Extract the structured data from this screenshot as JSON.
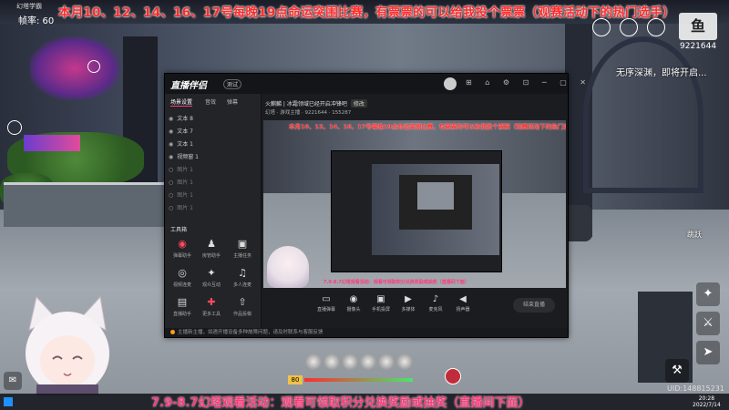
{
  "top_banner": "本月10、12、14、16、17号每晚19点命运突围比赛，有票票的可以给我投个票票（观赛活动下的热门选手）",
  "bottom_banner": "7.9-8.7幻塔观看活动：观看可领取积分兑换奖励或抽奖（直播间下面）",
  "game": {
    "fps_label": "帧率: 60",
    "tl_tab": "幻塔学霸",
    "right_logo": "鱼",
    "right_id": "9221644",
    "right_notice": "无序深渊，即将开启...",
    "hp_value": "80",
    "hp_fill_fraction": 0.85,
    "uid": "UID:148815231",
    "clock_time": "20:28",
    "clock_date": "2022/7/14",
    "right_label": "跳跃"
  },
  "app": {
    "logo": "直播伴侣",
    "logo_badge": "测试",
    "win_controls": "⊞ ⌂ ⚙ ⊡ ─ ▢ ✕",
    "left_tabs": [
      "场景设置",
      "音效",
      "弹幕"
    ],
    "layers": [
      {
        "label": "文本 8"
      },
      {
        "label": "文本 7"
      },
      {
        "label": "文本 1"
      },
      {
        "label": "视频窗 1"
      },
      {
        "label": "图片 1"
      },
      {
        "label": "图片 1"
      },
      {
        "label": "图片 1"
      },
      {
        "label": "图片 1"
      }
    ],
    "tools_title": "工具箱",
    "tools": [
      {
        "icon": "◉",
        "label": "弹幕助手",
        "red": true
      },
      {
        "icon": "♟",
        "label": "房管助手",
        "red": false
      },
      {
        "icon": "▣",
        "label": "主播任务",
        "red": false
      },
      {
        "icon": "◎",
        "label": "视频连麦",
        "red": false
      },
      {
        "icon": "✦",
        "label": "观众互动",
        "red": false
      },
      {
        "icon": "♫",
        "label": "多人连麦",
        "red": false
      },
      {
        "icon": "▤",
        "label": "直播助手",
        "red": false
      },
      {
        "icon": "✚",
        "label": "更多工具",
        "red": true
      },
      {
        "icon": "⇧",
        "label": "作品投稿",
        "red": false
      },
      {
        "icon": "▦",
        "label": "数据中心",
        "red": false
      },
      {
        "icon": "◫",
        "label": "直播回放",
        "red": false
      },
      {
        "icon": "⋯",
        "label": "更多",
        "red": false
      }
    ],
    "main_title": "火麒麟 | 冰霜领域已经开启冲锋吧",
    "main_tag": "修改",
    "main_sub": "幻塔  · 游戏主播  · 9221644  · 155287",
    "preview_banner": "本月10、12、14、16、17号每晚19点命运突围比赛，有票票的可以给我投个票票（观赛活动下的热门选手）",
    "preview_bottom_text": "7.9-8.7幻塔观看活动：观看可领取积分兑换奖励或抽奖（直播间下面）",
    "bottom_tools": [
      {
        "icon": "▭",
        "label": "直播弹幕"
      },
      {
        "icon": "◉",
        "label": "摄像头"
      },
      {
        "icon": "▣",
        "label": "手机投屏"
      },
      {
        "icon": "▶",
        "label": "多媒体"
      },
      {
        "icon": "♪",
        "label": "麦克风"
      },
      {
        "icon": "◀",
        "label": "扬声器"
      }
    ],
    "live_button": "结束直播",
    "status_text": "主播新主播，如遇开播设备多种故障问题，请及时联系与客服反馈"
  }
}
